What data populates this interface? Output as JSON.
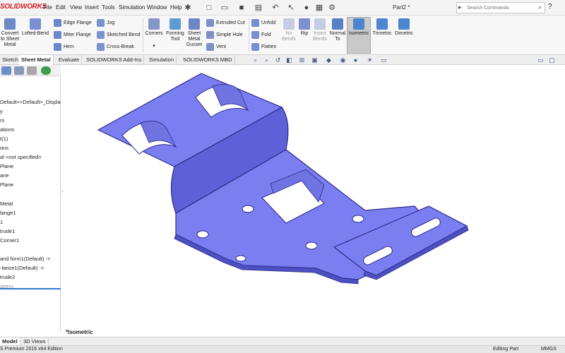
{
  "app": {
    "logo": "SOLIDWORKS",
    "menus": [
      "File",
      "Edit",
      "View",
      "Insert",
      "Tools",
      "Simulation",
      "Window",
      "Help"
    ],
    "document_title": "Part2 *",
    "search_placeholder": "Search Commands",
    "help_symbol": "?"
  },
  "ribbon": {
    "large": [
      {
        "label": "Convert to Sheet Metal"
      },
      {
        "label": "Lofted-Bend"
      },
      {
        "label": "Corners"
      },
      {
        "label": "Forming Tool"
      },
      {
        "label": "Sheet Metal Gusset"
      },
      {
        "label": "Unfold"
      },
      {
        "label": "No Bends"
      },
      {
        "label": "Rip"
      },
      {
        "label": "Insert Bends"
      },
      {
        "label": "Normal To"
      },
      {
        "label": "Isometric"
      },
      {
        "label": "Trimetric"
      },
      {
        "label": "Dimetric"
      }
    ],
    "small": [
      {
        "label": "Edge Flange"
      },
      {
        "label": "Miter Flange"
      },
      {
        "label": "Hem"
      },
      {
        "label": "Jog"
      },
      {
        "label": "Sketched Bend"
      },
      {
        "label": "Cross-Break"
      },
      {
        "label": "Extruded Cut"
      },
      {
        "label": "Simple Hole"
      },
      {
        "label": "Vent"
      },
      {
        "label": "Fold"
      },
      {
        "label": "Flatten"
      }
    ]
  },
  "tabs": [
    "Sketch",
    "Sheet Metal",
    "Evaluate",
    "SOLIDWORKS Add-Ins",
    "Simulation",
    "SOLIDWORKS MBD"
  ],
  "active_tab": "Sheet Metal",
  "tree": {
    "rows": [
      "Default<<Default>_Displa",
      "y",
      "rs",
      "ations",
      "t(1)",
      "ons",
      "al <not specified>",
      "Plane",
      "ane",
      "Plane",
      "Metal",
      "lange1",
      "1",
      "trude1",
      "Corner1",
      "and form1(Default) ->",
      "-lance1(Default) ->",
      "trude2",
      "attern"
    ]
  },
  "view": {
    "label": "*Isometric"
  },
  "bottom_tabs": [
    "Model",
    "3D Views"
  ],
  "status": {
    "edition": "S Premium 2016 x64 Edition",
    "mode": "Editing Part",
    "units": "MMGS"
  },
  "colors": {
    "part_face": "#7b7ef0",
    "part_edge": "#2a2c8a",
    "part_side": "#4d50c2",
    "accent": "#d41f26",
    "active_blue": "#2d7bd0"
  }
}
